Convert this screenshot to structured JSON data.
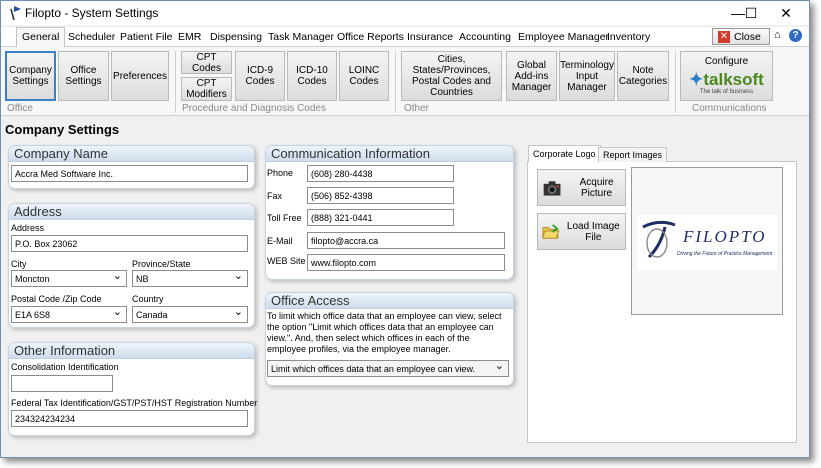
{
  "window": {
    "title": "Filopto - System Settings"
  },
  "titlebar_buttons": {
    "minimize": "—",
    "maximize": "☐",
    "close": "✕"
  },
  "menu_tabs": [
    "General",
    "Scheduler",
    "Patient File",
    "EMR",
    "Dispensing",
    "Task Manager",
    "Office Reports",
    "Insurance",
    "Accounting",
    "Employee Manager",
    "Inventory"
  ],
  "close_button": {
    "label": "Close"
  },
  "ribbon": {
    "company_settings": "Company Settings",
    "office_settings": "Office Settings",
    "preferences": "Preferences",
    "cpt_codes": "CPT Codes",
    "cpt_modifiers": "CPT Modifiers",
    "icd9_codes": "ICD-9 Codes",
    "icd10_codes": "ICD-10 Codes",
    "loinc_codes": "LOINC Codes",
    "cities": "Cities, States/Provinces, Postal Codes and Countries",
    "global_addins": "Global Add-ins Manager",
    "terminology": "Terminology Input Manager",
    "note_categories": "Note Categories",
    "configure": "Configure",
    "talksoft_logo_text": "talksoft",
    "talksoft_tagline": "The talk of business",
    "groups": {
      "office": "Office",
      "procedure": "Procedure and Diagnosis Codes",
      "other": "Other",
      "communications": "Communications"
    }
  },
  "page_title": "Company Settings",
  "company_name": {
    "header": "Company Name",
    "value": "Accra Med Software Inc."
  },
  "address": {
    "header": "Address",
    "address_label": "Address",
    "address_value": "P.O. Box 23062",
    "city_label": "City",
    "city_value": "Moncton",
    "province_label": "Province/State",
    "province_value": "NB",
    "postal_label": "Postal Code /Zip Code",
    "postal_value": "E1A 6S8",
    "country_label": "Country",
    "country_value": "Canada"
  },
  "other_information": {
    "header": "Other Information",
    "consolidation_label": "Consolidation Identification",
    "consolidation_value": "",
    "tax_label": "Federal Tax Identification/GST/PST/HST Registration Number",
    "tax_value": "234324234234"
  },
  "communication": {
    "header": "Communication Information",
    "phone_label": "Phone",
    "phone_value": "(608) 280-4438",
    "fax_label": "Fax",
    "fax_value": "(506) 852-4398",
    "tollfree_label": "Toll Free",
    "tollfree_value": "(888) 321-0441",
    "email_label": "E-Mail",
    "email_value": "filopto@accra.ca",
    "website_label": "WEB Site",
    "website_value": "www.filopto.com"
  },
  "office_access": {
    "header": "Office Access",
    "description": "To limit which office data that an employee can view, select the option \"Limit which offices data that an employee can view.\".  And, then select which offices in each of the employee profiles, via the employee manager.",
    "dropdown_value": "Limit which offices data that an employee can view."
  },
  "images": {
    "tab_corporate": "Corporate Logo",
    "tab_report": "Report Images",
    "acquire_label": "Acquire Picture",
    "load_label": "Load Image File",
    "logo_text": "FILOPTO",
    "logo_tagline": "Driving the Future of Practice Management"
  }
}
